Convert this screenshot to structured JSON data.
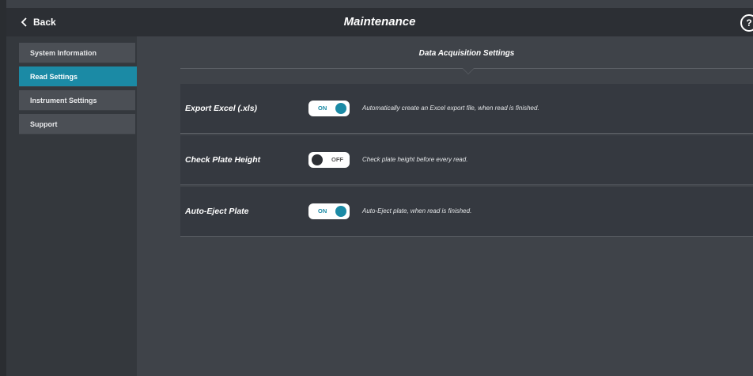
{
  "header": {
    "back_label": "Back",
    "title": "Maintenance",
    "help_glyph": "?"
  },
  "sidebar": {
    "items": [
      {
        "label": "System Information",
        "active": false
      },
      {
        "label": "Read Settings",
        "active": true
      },
      {
        "label": "Instrument Settings",
        "active": false
      },
      {
        "label": "Support",
        "active": false
      }
    ]
  },
  "main": {
    "section_title": "Data Acquisition Settings",
    "settings": [
      {
        "label": "Export Excel (.xls)",
        "toggle": "ON",
        "state": "on",
        "description": "Automatically create an Excel export file, when read is finished."
      },
      {
        "label": "Check Plate Height",
        "toggle": "OFF",
        "state": "off",
        "description": "Check plate height before every read."
      },
      {
        "label": "Auto-Eject Plate",
        "toggle": "ON",
        "state": "on",
        "description": "Auto-Eject plate, when read is finished."
      }
    ]
  },
  "colors": {
    "accent": "#1b8aa5",
    "header_bg": "#2c2f34",
    "content_bg": "#3f4349",
    "row_bg": "#353940"
  },
  "icons": {
    "back": "chevron-left-icon",
    "help": "question-circle-icon"
  }
}
